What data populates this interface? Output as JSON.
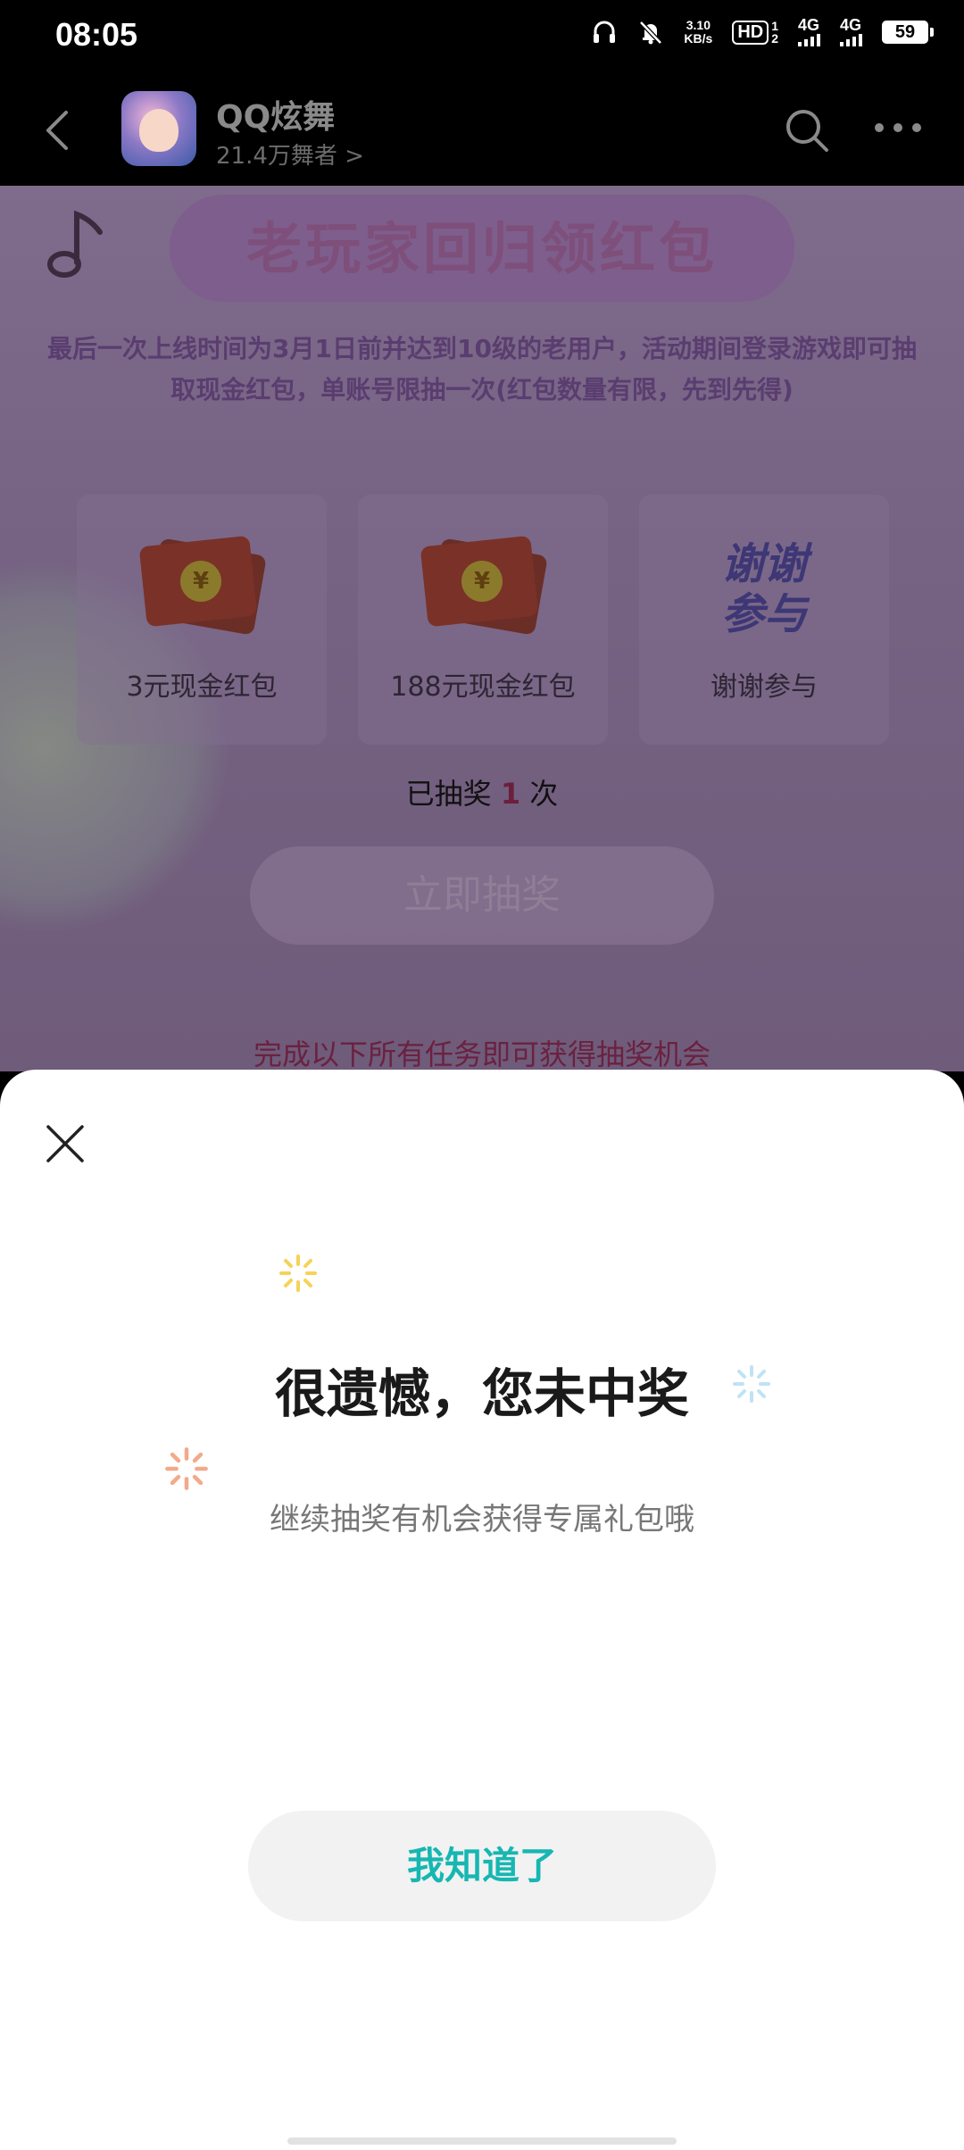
{
  "status_bar": {
    "time": "08:05",
    "speed_value": "3.10",
    "speed_unit": "KB/s",
    "hd_label": "HD",
    "hd_sim": "1",
    "hd_sim2": "2",
    "signal1": "4G",
    "signal2": "4G",
    "battery": "59"
  },
  "header": {
    "app_name": "QQ炫舞",
    "followers": "21.4万舞者 >"
  },
  "background_page": {
    "banner_title": "老玩家回归领红包",
    "description": "最后一次上线时间为3月1日前并达到10级的老用户，活动期间登录游戏即可抽取现金红包，单账号限抽一次(红包数量有限，先到先得)",
    "prizes": [
      {
        "label": "3元现金红包"
      },
      {
        "label": "188元现金红包"
      },
      {
        "label": "谢谢参与",
        "art": "谢谢\n参与"
      }
    ],
    "coin_symbol": "¥",
    "draw_count_prefix": "已抽奖",
    "draw_count_value": "1",
    "draw_count_suffix": "次",
    "draw_button": "立即抽奖",
    "task_tip": "完成以下所有任务即可获得抽奖机会"
  },
  "modal": {
    "title": "很遗憾，您未中奖",
    "subtitle": "继续抽奖有机会获得专属礼包哦",
    "confirm_button": "我知道了"
  },
  "colors": {
    "accent": "#16b7b2",
    "overlay": "#766383"
  }
}
